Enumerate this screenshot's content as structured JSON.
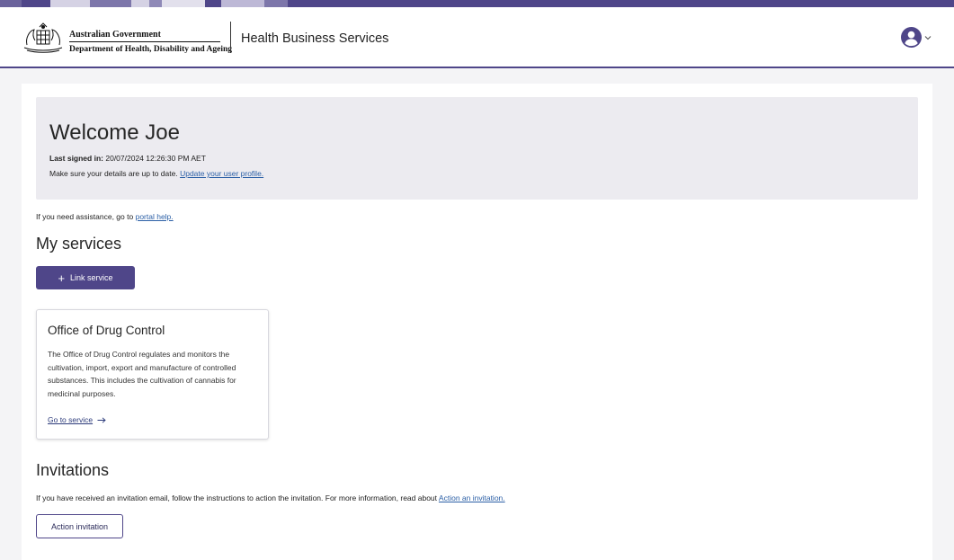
{
  "header": {
    "gov_line1": "Australian Government",
    "gov_line2": "Department of Health, Disability and Ageing",
    "app_title": "Health Business Services",
    "user_icon": "user-circle-icon",
    "menu_icon": "chevron-down-icon"
  },
  "colors": {
    "brand": "#4f4689",
    "link": "#2b5fa6",
    "welcome_bg": "#ecebf0"
  },
  "welcome": {
    "heading": "Welcome Joe",
    "last_signed_label": "Last signed in:",
    "last_signed_value": "20/07/2024 12:26:30 PM AET",
    "details_text": "Make sure your details are up to date.",
    "profile_link": "Update your user profile."
  },
  "help": {
    "text": "If you need assistance, go to",
    "link": "portal help."
  },
  "services": {
    "heading": "My services",
    "link_button_label": "Link service",
    "cards": [
      {
        "title": "Office of Drug Control",
        "description": "The Office of Drug Control regulates and monitors the cultivation, import, export and manufacture of controlled substances.  This includes the cultivation of cannabis for medicinal purposes.",
        "action_label": "Go to service"
      }
    ]
  },
  "invitations": {
    "heading": "Invitations",
    "text": "If you have received an invitation email, follow the instructions to action the invitation. For more information, read about",
    "link": "Action an invitation.",
    "button_label": "Action invitation"
  }
}
